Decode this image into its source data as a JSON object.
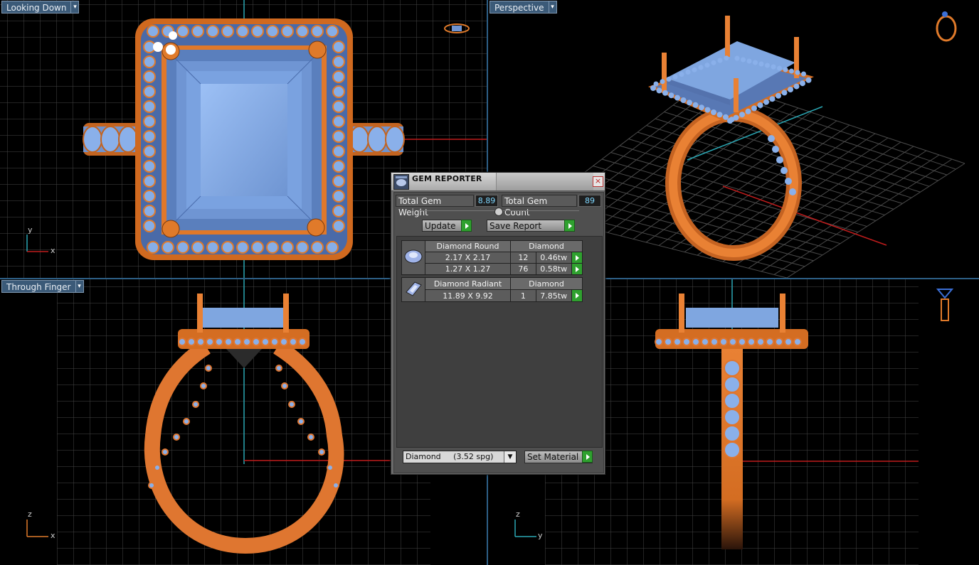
{
  "viewports": {
    "top_left": {
      "label": "Looking Down",
      "axis_v": "y",
      "axis_h": "x"
    },
    "top_right": {
      "label": "Perspective"
    },
    "bottom_left": {
      "label": "Through Finger",
      "axis_v": "z",
      "axis_h": "x"
    },
    "bottom_right": {
      "label": "",
      "axis_v": "z",
      "axis_h": "y"
    }
  },
  "gem_reporter": {
    "title": "GEM REPORTER",
    "close": "×",
    "total_weight_label": "Total Gem Weight",
    "total_weight_value": "8.89",
    "total_count_label": "Total Gem Count",
    "total_count_value": "89",
    "update_label": "Update",
    "save_report_label": "Save Report",
    "groups": [
      {
        "shape": "Diamond Round",
        "material": "Diamond",
        "icon": "round-gem-icon",
        "rows": [
          {
            "size": "2.17 X 2.17",
            "count": "12",
            "weight": "0.46tw"
          },
          {
            "size": "1.27 X 1.27",
            "count": "76",
            "weight": "0.58tw"
          }
        ]
      },
      {
        "shape": "Diamond Radiant",
        "material": "Diamond",
        "icon": "radiant-gem-icon",
        "rows": [
          {
            "size": "11.89 X 9.92",
            "count": "1",
            "weight": "7.85tw"
          }
        ]
      }
    ],
    "material_select": "Diamond     (3.52 spg)",
    "set_material_label": "Set Material"
  },
  "colors": {
    "metal": "#e0782a",
    "gem": "#7fa6e0",
    "grid": "#4a4a4a",
    "axis_red": "#c01c1c",
    "axis_cyan": "#2aa7b4",
    "panel_bg": "#4f4f4f"
  }
}
